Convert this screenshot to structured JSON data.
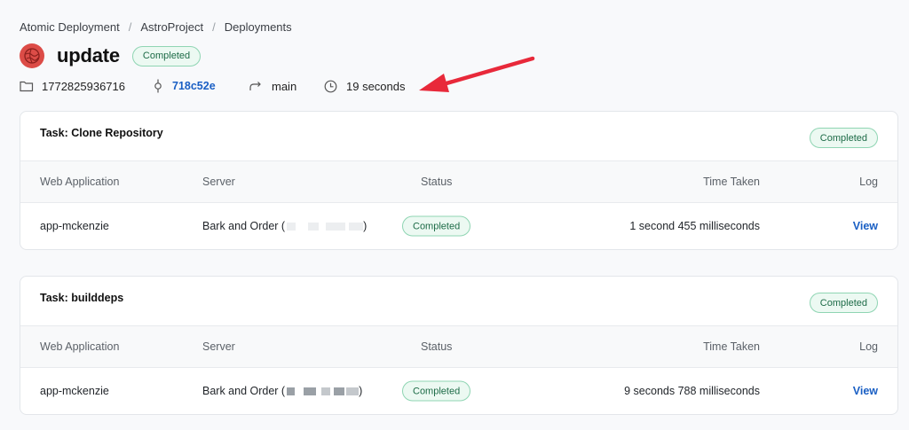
{
  "breadcrumb": [
    "Atomic Deployment",
    "AstroProject",
    "Deployments"
  ],
  "breadcrumb_separator": "/",
  "header": {
    "title": "update",
    "status": "Completed",
    "avatar_color": "#dc4c47"
  },
  "meta": {
    "folder_id": "1772825936716",
    "commit": "718c52e",
    "branch": "main",
    "duration": "19 seconds"
  },
  "columns": {
    "app": "Web Application",
    "server": "Server",
    "status": "Status",
    "time": "Time Taken",
    "log": "Log"
  },
  "tasks": [
    {
      "title": "Task: Clone Repository",
      "status": "Completed",
      "row": {
        "app": "app-mckenzie",
        "server_prefix": "Bark and Order (",
        "server_suffix": ")",
        "status": "Completed",
        "time": "1 second 455 milliseconds",
        "log": "View"
      }
    },
    {
      "title": "Task: builddeps",
      "status": "Completed",
      "row": {
        "app": "app-mckenzie",
        "server_prefix": "Bark and Order (",
        "server_suffix": ")",
        "status": "Completed",
        "time": "9 seconds 788 milliseconds",
        "log": "View"
      }
    }
  ],
  "colors": {
    "link": "#1a5fc4",
    "badge_border": "#8fd5b3",
    "badge_text": "#1d6b47",
    "annotation_arrow": "#e8293a"
  }
}
